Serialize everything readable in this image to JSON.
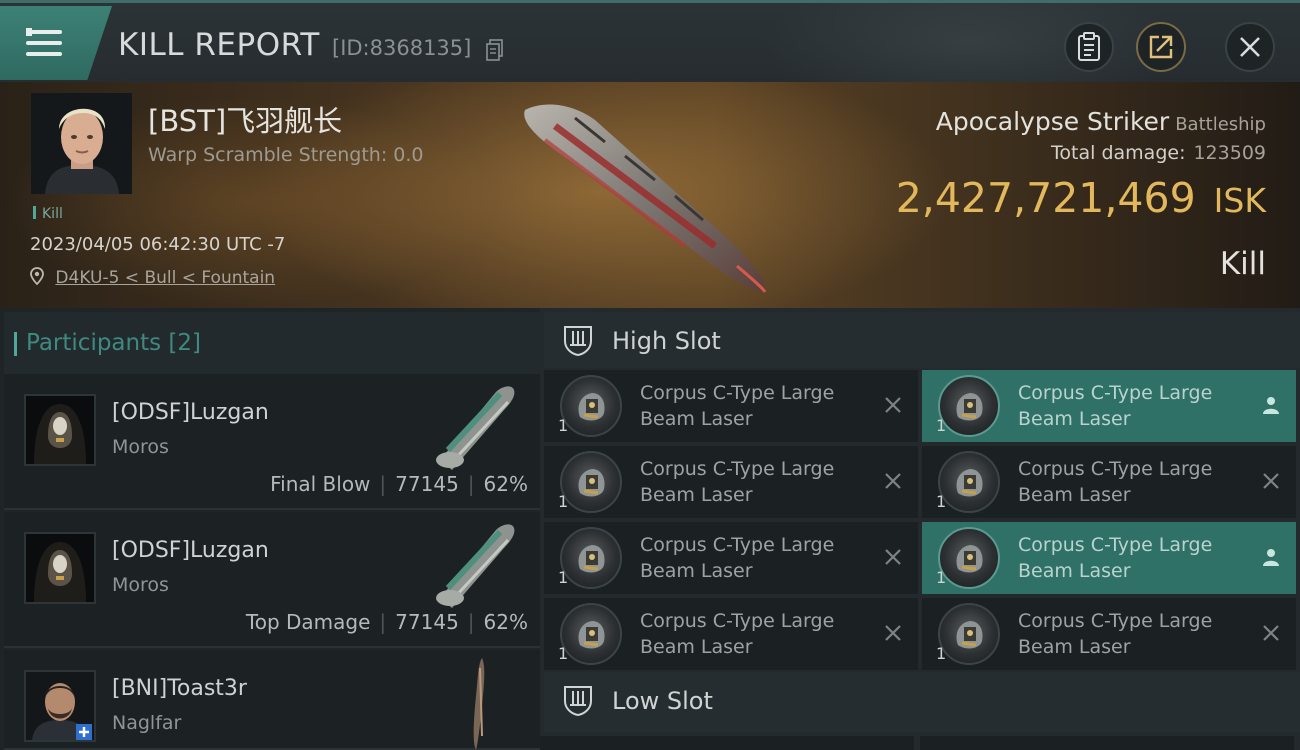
{
  "header": {
    "title": "KILL REPORT",
    "report_id": "[ID:8368135]",
    "icons": [
      "menu-icon",
      "copy-icon",
      "clipboard-icon",
      "share-icon",
      "close-icon"
    ]
  },
  "victim": {
    "pilot_name": "[BST]飞羽舰长",
    "warp_scramble": "Warp Scramble Strength: 0.0",
    "tag": "Kill",
    "datetime": "2023/04/05 06:42:30 UTC -7",
    "location": "D4KU-5 < Bull < Fountain",
    "ship_name": "Apocalypse Striker",
    "ship_class": "Battleship",
    "total_damage_label": "Total damage:",
    "total_damage": "123509",
    "isk_value": "2,427,721,469",
    "isk_unit": "ISK",
    "result": "Kill"
  },
  "participants": {
    "title": "Participants [2]",
    "rows": [
      {
        "name": "[ODSF]Luzgan",
        "ship": "Moros",
        "role": "Final Blow",
        "damage": "77145",
        "percent": "62%"
      },
      {
        "name": "[ODSF]Luzgan",
        "ship": "Moros",
        "role": "Top Damage",
        "damage": "77145",
        "percent": "62%"
      },
      {
        "name": "[BNI]Toast3r",
        "ship": "Naglfar",
        "role": "",
        "damage": "",
        "percent": ""
      }
    ]
  },
  "slots": {
    "high_slot": {
      "title": "High Slot",
      "modules": [
        {
          "name": "Corpus C-Type Large Beam Laser",
          "qty": "1",
          "status": "destroyed",
          "action_icon": "x-icon"
        },
        {
          "name": "Corpus C-Type Large Beam Laser",
          "qty": "1",
          "status": "dropped",
          "action_icon": "person-icon"
        },
        {
          "name": "Corpus C-Type Large Beam Laser",
          "qty": "1",
          "status": "destroyed",
          "action_icon": "x-icon"
        },
        {
          "name": "Corpus C-Type Large Beam Laser",
          "qty": "1",
          "status": "destroyed",
          "action_icon": "x-icon"
        },
        {
          "name": "Corpus C-Type Large Beam Laser",
          "qty": "1",
          "status": "destroyed",
          "action_icon": "x-icon"
        },
        {
          "name": "Corpus C-Type Large Beam Laser",
          "qty": "1",
          "status": "dropped",
          "action_icon": "person-icon"
        },
        {
          "name": "Corpus C-Type Large Beam Laser",
          "qty": "1",
          "status": "destroyed",
          "action_icon": "x-icon"
        },
        {
          "name": "Corpus C-Type Large Beam Laser",
          "qty": "1",
          "status": "destroyed",
          "action_icon": "x-icon"
        }
      ]
    },
    "low_slot": {
      "title": "Low Slot"
    }
  },
  "colors": {
    "accent_teal": "#3d8176",
    "isk_gold": "#e3b85c",
    "highlight_row": "#2f7067"
  }
}
